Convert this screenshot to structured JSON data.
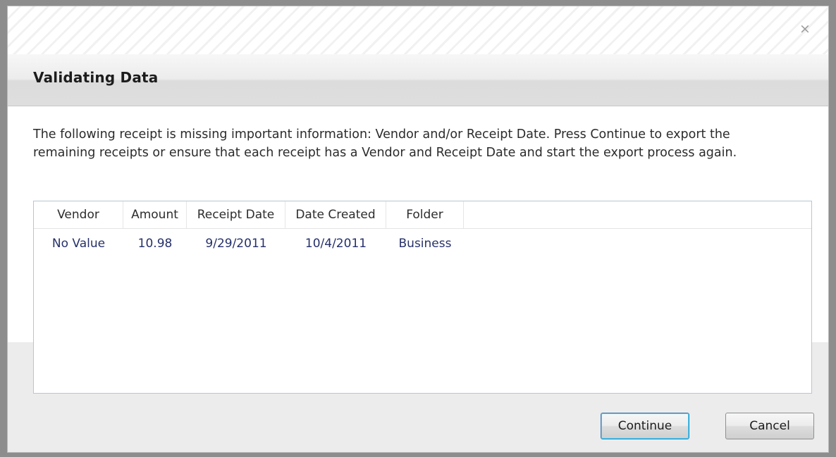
{
  "dialog": {
    "title": "Validating Data",
    "close_symbol": "×",
    "message": "The following receipt is missing important information: Vendor and/or Receipt Date. Press Continue to export the remaining receipts or ensure that each receipt has a Vendor and Receipt Date and start the export process again."
  },
  "table": {
    "columns": [
      "Vendor",
      "Amount",
      "Receipt Date",
      "Date Created",
      "Folder"
    ],
    "rows": [
      [
        "No Value",
        "10.98",
        "9/29/2011",
        "10/4/2011",
        "Business"
      ]
    ]
  },
  "buttons": {
    "continue_label": "Continue",
    "cancel_label": "Cancel"
  },
  "icons": {
    "close": "close-icon"
  },
  "colors": {
    "frame": "#8d8d8d",
    "cell_text": "#26306a",
    "grid_border": "#b8c5d3",
    "default_button_border": "#3c7fb1"
  }
}
